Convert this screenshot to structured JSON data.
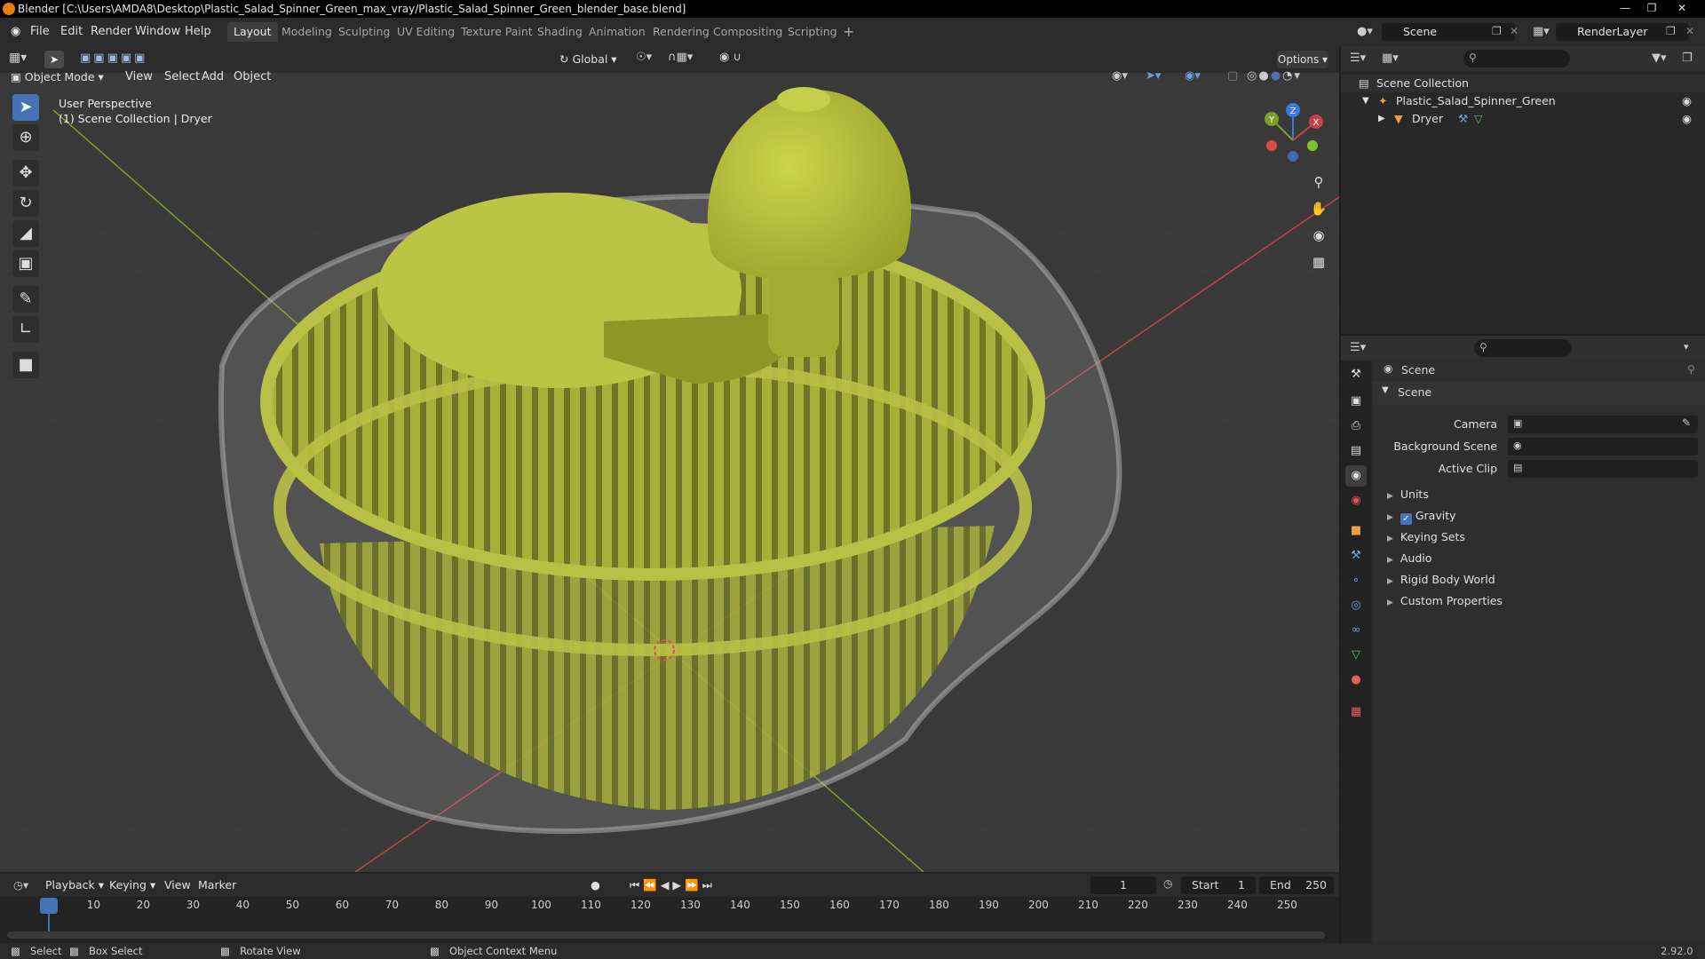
{
  "window": {
    "title": "Blender [C:\\Users\\AMDA8\\Desktop\\Plastic_Salad_Spinner_Green_max_vray/Plastic_Salad_Spinner_Green_blender_base.blend]"
  },
  "menu": [
    "File",
    "Edit",
    "Render",
    "Window",
    "Help"
  ],
  "workspaces": [
    "Layout",
    "Modeling",
    "Sculpting",
    "UV Editing",
    "Texture Paint",
    "Shading",
    "Animation",
    "Rendering",
    "Compositing",
    "Scripting"
  ],
  "active_workspace": "Layout",
  "scene_field": "Scene",
  "renderlayer_field": "RenderLayer",
  "viewport": {
    "transform_orientation": "Global",
    "options_label": "Options",
    "mode": "Object Mode",
    "menus": [
      "View",
      "Select",
      "Add",
      "Object"
    ],
    "perspective_label": "User Perspective",
    "collection_label": "(1) Scene Collection | Dryer",
    "gizmo": {
      "x": "X",
      "y": "Y",
      "z": "Z"
    }
  },
  "outliner": {
    "root": "Scene Collection",
    "collection": "Plastic_Salad_Spinner_Green",
    "object": "Dryer"
  },
  "properties": {
    "breadcrumb": "Scene",
    "panel_title": "Scene",
    "camera_label": "Camera",
    "background_scene_label": "Background Scene",
    "active_clip_label": "Active Clip",
    "subpanels": [
      "Units",
      "Gravity",
      "Keying Sets",
      "Audio",
      "Rigid Body World",
      "Custom Properties"
    ],
    "gravity_checked": true
  },
  "timeline": {
    "menus": [
      "Playback",
      "Keying",
      "View",
      "Marker"
    ],
    "current_frame": "1",
    "start_label": "Start",
    "start_value": "1",
    "end_label": "End",
    "end_value": "250",
    "ticks": [
      "1",
      "10",
      "20",
      "30",
      "40",
      "50",
      "60",
      "70",
      "80",
      "90",
      "100",
      "110",
      "120",
      "130",
      "140",
      "150",
      "160",
      "170",
      "180",
      "190",
      "200",
      "210",
      "220",
      "230",
      "240",
      "250"
    ]
  },
  "status": {
    "select": "Select",
    "box_select": "Box Select",
    "rotate_view": "Rotate View",
    "context_menu": "Object Context Menu",
    "version": "2.92.0"
  },
  "colors": {
    "accent": "#4772b3",
    "spinner_green": "#b4bc3c",
    "axis_x": "#c4434d",
    "axis_y": "#7ea02a",
    "frame_marker": "#4772b3"
  }
}
